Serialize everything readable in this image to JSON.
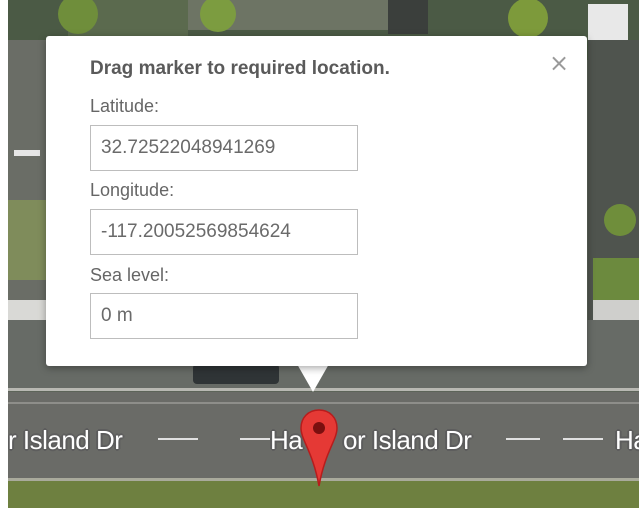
{
  "dialog": {
    "title": "Drag marker to required location.",
    "close_glyph": "×",
    "fields": [
      {
        "label": "Latitude:",
        "value": "32.72522048941269"
      },
      {
        "label": "Longitude:",
        "value": "-117.20052569854624"
      },
      {
        "label": "Sea level:",
        "value": "0 m"
      }
    ]
  },
  "map": {
    "street_labels": [
      "r Island Dr",
      "Ha",
      "or Island Dr",
      "Ha"
    ],
    "marker_color": "#e53935"
  }
}
